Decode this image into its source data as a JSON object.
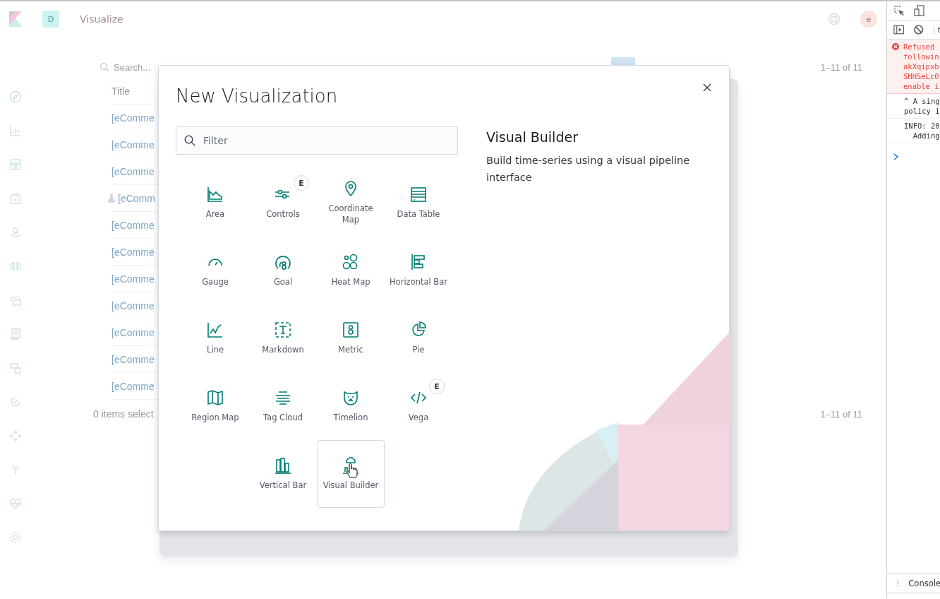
{
  "header": {
    "space_badge": "D",
    "app_title": "Visualize",
    "avatar": "e"
  },
  "listing": {
    "search": {
      "placeholder": "Search..."
    },
    "pagination": "1–11 of 11",
    "columns": [
      "Title"
    ],
    "rows": [
      {
        "title": "[eComme",
        "experimental": false
      },
      {
        "title": "[eComme",
        "experimental": false
      },
      {
        "title": "[eComme",
        "experimental": false
      },
      {
        "title": "[eComm",
        "experimental": true
      },
      {
        "title": "[eComme",
        "experimental": false
      },
      {
        "title": "[eComme",
        "experimental": false
      },
      {
        "title": "[eComme",
        "experimental": false
      },
      {
        "title": "[eComme",
        "experimental": false
      },
      {
        "title": "[eComme",
        "experimental": false
      },
      {
        "title": "[eComme",
        "experimental": false
      },
      {
        "title": "[eComme",
        "experimental": false
      }
    ],
    "selection": "0 items select",
    "footer_pagination": "1–11 of 11"
  },
  "modal": {
    "title": "New Visualization",
    "filter": {
      "placeholder": "Filter"
    },
    "types": [
      {
        "label": "Area",
        "selected": false
      },
      {
        "label": "Controls",
        "badge": "E",
        "selected": false
      },
      {
        "label": "Coordinate Map",
        "selected": false
      },
      {
        "label": "Data Table",
        "selected": false
      },
      {
        "label": "Gauge",
        "selected": false
      },
      {
        "label": "Goal",
        "selected": false
      },
      {
        "label": "Heat Map",
        "selected": false
      },
      {
        "label": "Horizontal Bar",
        "selected": false
      },
      {
        "label": "Line",
        "selected": false
      },
      {
        "label": "Markdown",
        "selected": false
      },
      {
        "label": "Metric",
        "selected": false
      },
      {
        "label": "Pie",
        "selected": false
      },
      {
        "label": "Region Map",
        "selected": false
      },
      {
        "label": "Tag Cloud",
        "selected": false
      },
      {
        "label": "Timelion",
        "selected": false
      },
      {
        "label": "Vega",
        "badge": "E",
        "selected": false
      },
      {
        "label": "Vertical Bar",
        "selected": false
      },
      {
        "label": "Visual Builder",
        "selected": true
      }
    ],
    "details": {
      "title": "Visual Builder",
      "description": "Build time-series using a visual pipeline interface"
    }
  },
  "devtools": {
    "filter_text": "t",
    "messages": [
      {
        "kind": "error",
        "lines": [
          "Refused",
          "followin",
          "akXqipxb",
          "SHHSeLc0",
          "enable i"
        ]
      },
      {
        "kind": "log",
        "lines": [
          "^ A sing",
          "policy i"
        ]
      },
      {
        "kind": "log",
        "lines": [
          "INFO: 20",
          "  Adding"
        ]
      }
    ],
    "drawer_tab": "Console"
  }
}
